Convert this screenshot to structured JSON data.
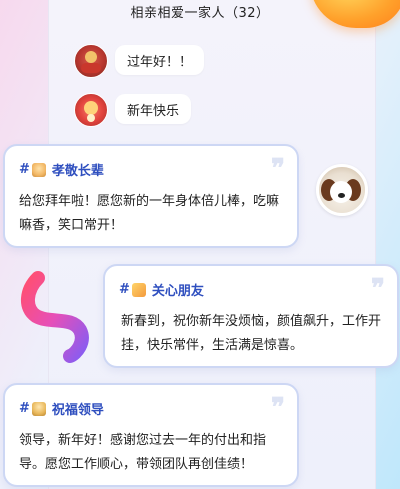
{
  "header": {
    "title": "相亲相爱一家人（32）"
  },
  "chat": {
    "messages": [
      {
        "avatar": "red-festive-avatar",
        "text": "过年好！！"
      },
      {
        "avatar": "red-lucky-avatar",
        "text": "新年快乐"
      }
    ]
  },
  "cards": [
    {
      "tag": "孝敬长辈",
      "hash": "#",
      "icon": "elder-emoji-icon",
      "body": "给您拜年啦！愿您新的一年身体倍儿棒，吃嘛嘛香，笑口常开！"
    },
    {
      "tag": "关心朋友",
      "hash": "#",
      "icon": "friends-emoji-icon",
      "body": "新春到，祝你新年没烦恼，颜值飙升，工作开挂，快乐常伴，生活满是惊喜。"
    },
    {
      "tag": "祝福领导",
      "hash": "#",
      "icon": "leader-emoji-icon",
      "body": "领导，新年好！感谢您过去一年的付出和指导。愿您工作顺心，带领团队再创佳绩！"
    }
  ],
  "colors": {
    "tag_text": "#2f4fbf",
    "card_border": "#cdd7f4",
    "accent_orange": "#ffa12b"
  }
}
